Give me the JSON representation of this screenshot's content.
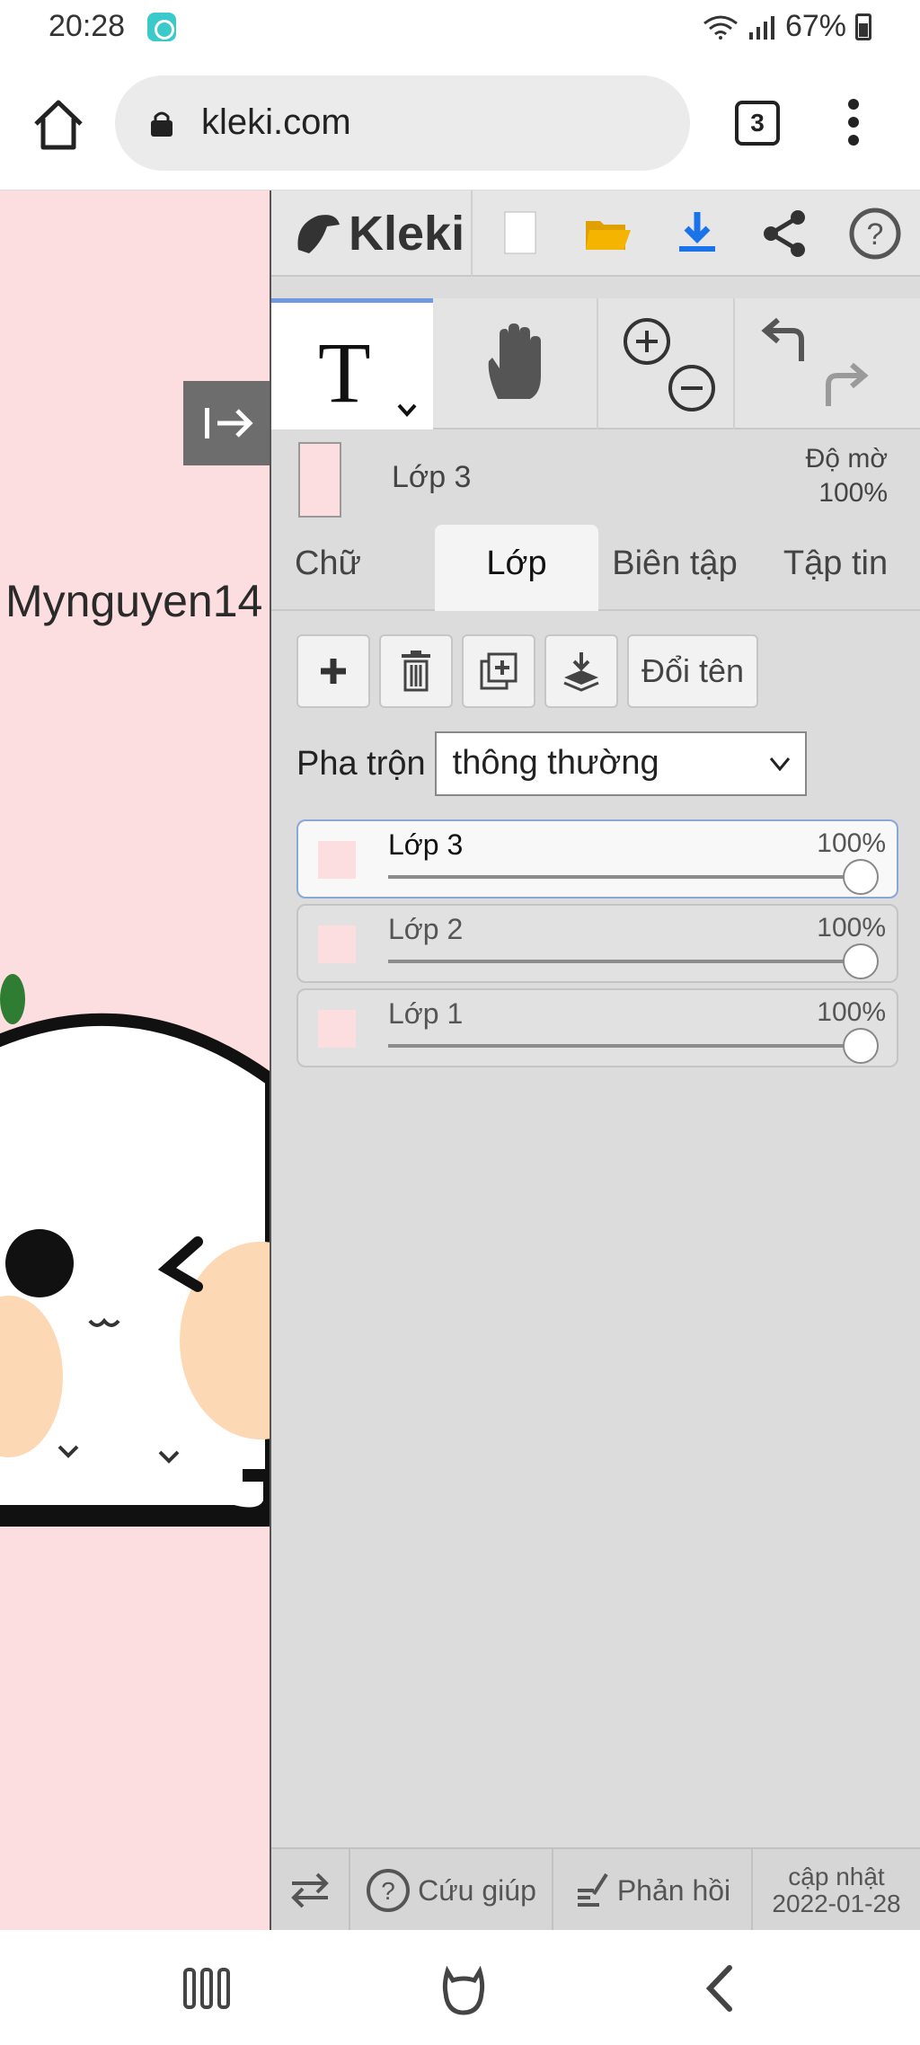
{
  "status_bar": {
    "time": "20:28",
    "battery": "67%",
    "icons": [
      "wifi-icon",
      "signal-icon",
      "battery-icon",
      "app-notification-icon"
    ]
  },
  "browser": {
    "url": "kleki.com",
    "tab_count": "3",
    "icons": [
      "home-icon",
      "lock-icon",
      "tabs-icon",
      "menu-icon"
    ]
  },
  "canvas": {
    "text": "Mynguyen14",
    "background": "#fcdde0"
  },
  "app": {
    "logo": "Kleki",
    "toolbar_icons": [
      "new-image-icon",
      "open-folder-icon",
      "download-icon",
      "share-icon",
      "help-icon"
    ],
    "tools": {
      "text_tool": "T",
      "icons": [
        "hand-icon",
        "zoom-in-icon",
        "zoom-out-icon",
        "undo-icon",
        "redo-icon"
      ]
    },
    "current_layer": {
      "name": "Lớp 3",
      "opacity_label": "Độ mờ",
      "opacity_value": "100%"
    },
    "tabs": [
      "Chữ",
      "Lớp",
      "Biên tập",
      "Tập tin"
    ],
    "active_tab": "Lớp",
    "layer_actions": {
      "rename": "Đổi tên",
      "icons": [
        "add-layer-icon",
        "delete-layer-icon",
        "duplicate-layer-icon",
        "merge-down-icon"
      ]
    },
    "blend": {
      "label": "Pha trộn",
      "value": "thông thường"
    },
    "layers": [
      {
        "name": "Lớp 3",
        "opacity": "100%",
        "opacity_fraction": 1.0,
        "active": true
      },
      {
        "name": "Lớp 2",
        "opacity": "100%",
        "opacity_fraction": 1.0,
        "active": false
      },
      {
        "name": "Lớp 1",
        "opacity": "100%",
        "opacity_fraction": 1.0,
        "active": false
      }
    ],
    "footer": {
      "help": "Cứu giúp",
      "feedback": "Phản hồi",
      "update_label": "cập nhật",
      "update_date": "2022-01-28"
    }
  },
  "colors": {
    "accent": "#6e9be0",
    "download": "#1a73e8",
    "folder": "#f5b400",
    "panel": "#dcdcdc"
  }
}
